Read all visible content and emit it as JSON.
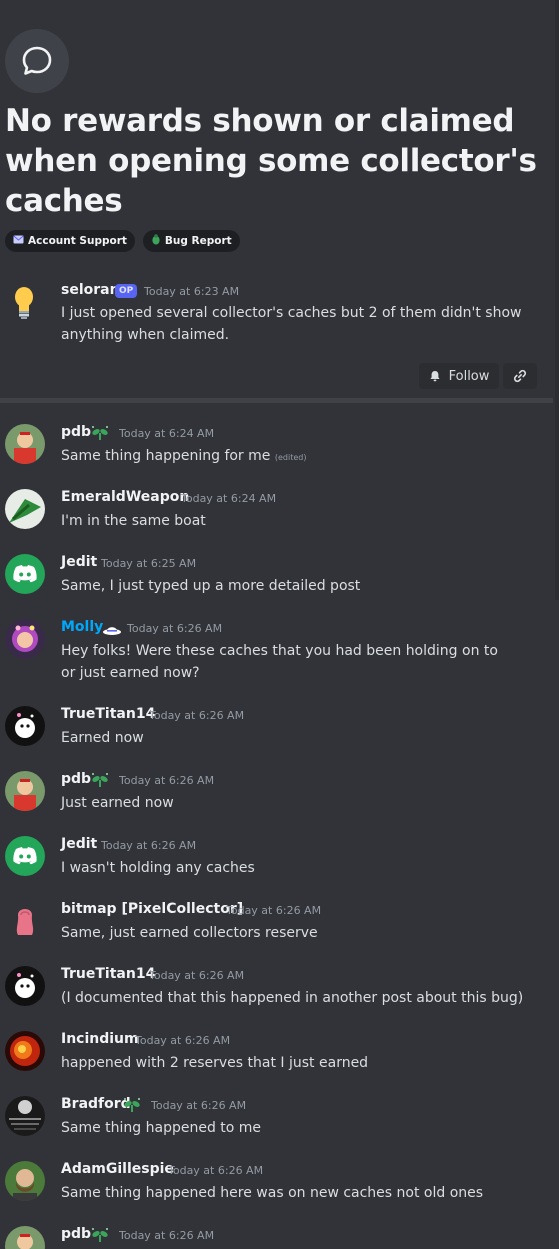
{
  "thread": {
    "title": "No rewards shown or claimed when opening some collector's caches",
    "tags": [
      {
        "label": "Account Support",
        "icon": "envelope-icon"
      },
      {
        "label": "Bug Report",
        "icon": "bug-icon"
      }
    ]
  },
  "op": {
    "author": "seloran",
    "badge": "OP",
    "time": "Today at 6:23 AM",
    "text": "I just opened several collector's caches but 2 of them didn't show anything when claimed."
  },
  "actions": {
    "follow_label": "Follow"
  },
  "messages": [
    {
      "author": "pdb",
      "time": "Today at 6:24 AM",
      "text": "Same thing happening for me",
      "edited": "(edited)"
    },
    {
      "author": "EmeraldWeapon",
      "time": "Today at 6:24 AM",
      "text": "I'm in the same boat"
    },
    {
      "author": "Jedit",
      "time": "Today at 6:25 AM",
      "text": "Same, I just typed up a more detailed post"
    },
    {
      "author": "Molly",
      "time": "Today at 6:26 AM",
      "text": "Hey folks! Were these caches that you had been holding on to or just earned now?"
    },
    {
      "author": "TrueTitan14",
      "time": "Today at 6:26 AM",
      "text": "Earned now"
    },
    {
      "author": "pdb",
      "time": "Today at 6:26 AM",
      "text": "Just earned now"
    },
    {
      "author": "Jedit",
      "time": "Today at 6:26 AM",
      "text": "I wasn't holding any caches"
    },
    {
      "author": "bitmap [PixelCollector]",
      "time": "Today at 6:26 AM",
      "text": "Same, just earned collectors reserve"
    },
    {
      "author": "TrueTitan14",
      "time": "Today at 6:26 AM",
      "text": "(I documented that this happened in another post about this bug)"
    },
    {
      "author": "Incindium",
      "time": "Today at 6:26 AM",
      "text": "happened with 2 reserves that I just earned"
    },
    {
      "author": "Bradford",
      "time": "Today at 6:26 AM",
      "text": "Same thing happened to me"
    },
    {
      "author": "AdamGillespie",
      "time": "Today at 6:26 AM",
      "text": "Same thing happened here was on new caches not old ones"
    },
    {
      "author": "pdb",
      "time": "Today at 6:26 AM",
      "text": ""
    }
  ],
  "colors": {
    "background": "#313338",
    "mod_name": "#00a8fc",
    "blurple": "#5865f2",
    "discord_green": "#23a55a",
    "sprout_green": "#3ba55c"
  }
}
